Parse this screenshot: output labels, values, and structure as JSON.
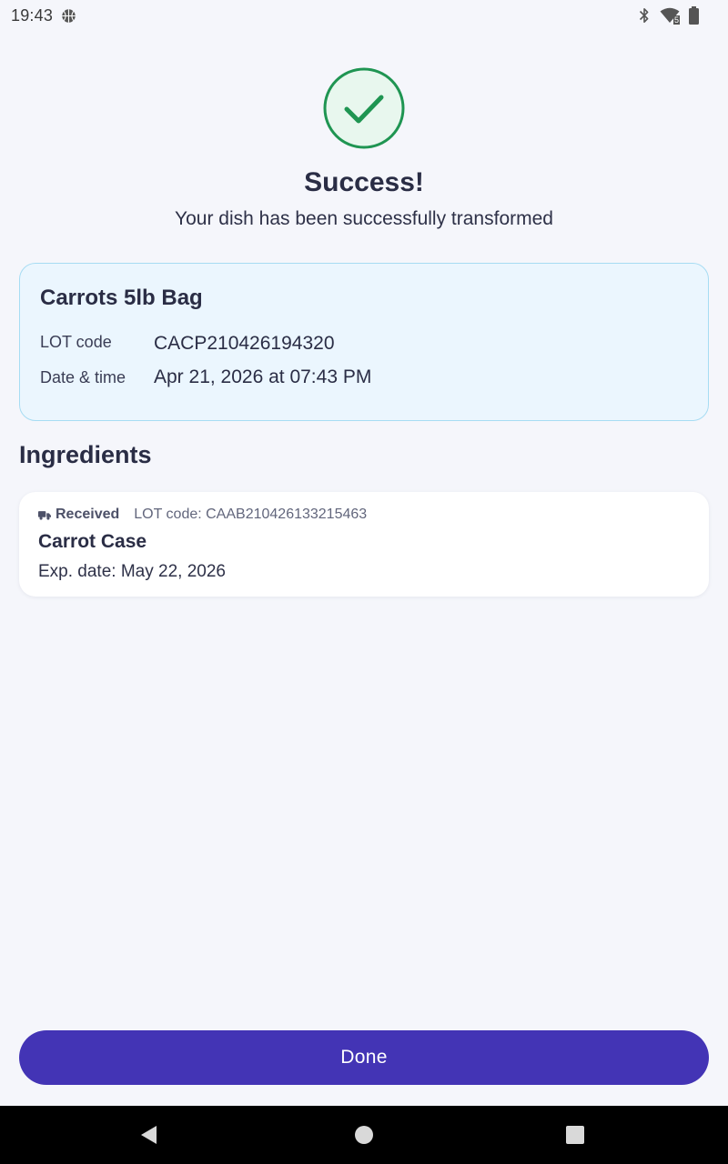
{
  "status_bar": {
    "time": "19:43",
    "icons": [
      "basketball-icon",
      "bluetooth-icon",
      "wifi-icon",
      "battery-icon"
    ],
    "wifi_badge": "5"
  },
  "success": {
    "icon": "check-circle-icon",
    "title": "Success!",
    "subtitle": "Your dish has been successfully transformed",
    "accent_color": "#1f9552",
    "icon_bg": "#e8f7ee"
  },
  "product": {
    "name": "Carrots 5lb Bag",
    "lot_label": "LOT code",
    "lot_value": "CACP210426194320",
    "datetime_label": "Date & time",
    "datetime_value": "Apr 21, 2026 at 07:43 PM"
  },
  "ingredients": {
    "title": "Ingredients",
    "items": [
      {
        "status_icon": "truck-icon",
        "status": "Received",
        "lot": "LOT code: CAAB210426133215463",
        "name": "Carrot Case",
        "exp": "Exp. date: May 22, 2026"
      }
    ]
  },
  "done_button": {
    "label": "Done",
    "color": "#4334b5"
  },
  "nav_bar": {
    "icons": [
      "back-icon",
      "home-icon",
      "recents-icon"
    ]
  }
}
